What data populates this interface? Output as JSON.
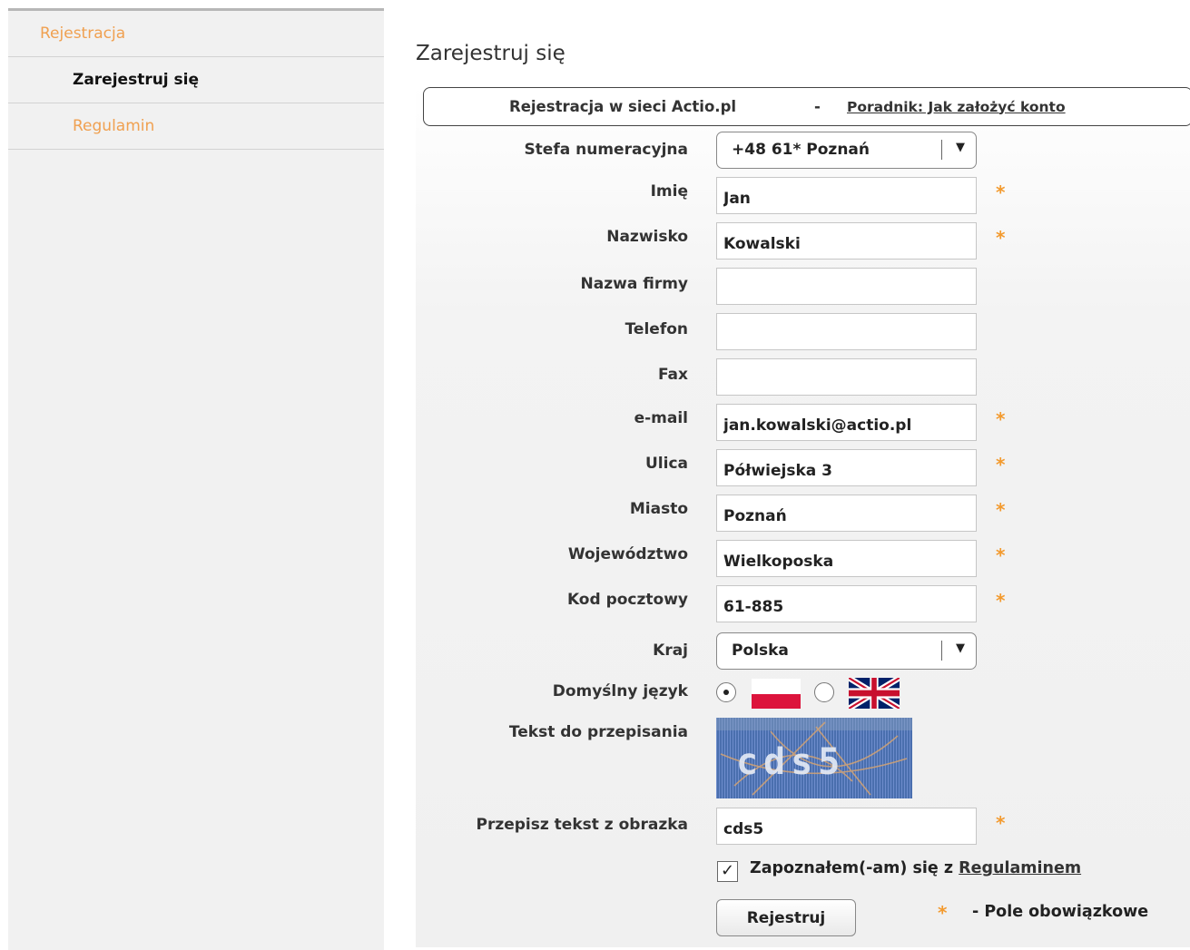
{
  "sidebar": {
    "root": "Rejestracja",
    "items": [
      {
        "label": "Zarejestruj się",
        "active": true
      },
      {
        "label": "Regulamin",
        "active": false
      }
    ]
  },
  "page_title": "Zarejestruj się",
  "info": {
    "text": "Rejestracja w sieci Actio.pl",
    "separator": "-",
    "link": "Poradnik: Jak założyć konto"
  },
  "form": {
    "zone": {
      "label": "Stefa numeracyjna",
      "value": "+48 61* Poznań"
    },
    "first_name": {
      "label": "Imię",
      "value": "Jan"
    },
    "last_name": {
      "label": "Nazwisko",
      "value": "Kowalski"
    },
    "company": {
      "label": "Nazwa firmy",
      "value": ""
    },
    "phone": {
      "label": "Telefon",
      "value": ""
    },
    "fax": {
      "label": "Fax",
      "value": ""
    },
    "email": {
      "label": "e-mail",
      "value": "jan.kowalski@actio.pl"
    },
    "street": {
      "label": "Ulica",
      "value": "Półwiejska 3"
    },
    "city": {
      "label": "Miasto",
      "value": "Poznań"
    },
    "province": {
      "label": "Województwo",
      "value": "Wielkoposka"
    },
    "postal_code": {
      "label": "Kod pocztowy",
      "value": "61-885"
    },
    "country": {
      "label": "Kraj",
      "value": "Polska"
    },
    "language": {
      "label": "Domyślny język",
      "selected": "pl"
    },
    "captcha": {
      "label": "Tekst do przepisania",
      "image_text": "cds5"
    },
    "captcha_input": {
      "label": "Przepisz tekst z obrazka",
      "value": "cds5"
    },
    "terms": {
      "text": "Zapoznałem(-am) się z ",
      "link": "Regulaminem",
      "checked": true
    },
    "submit": "Rejestruj",
    "required_star": "*",
    "required_note": "- Pole obowiązkowe"
  },
  "colors": {
    "accent": "#f39a2e",
    "sidebar_link": "#f0a050"
  }
}
